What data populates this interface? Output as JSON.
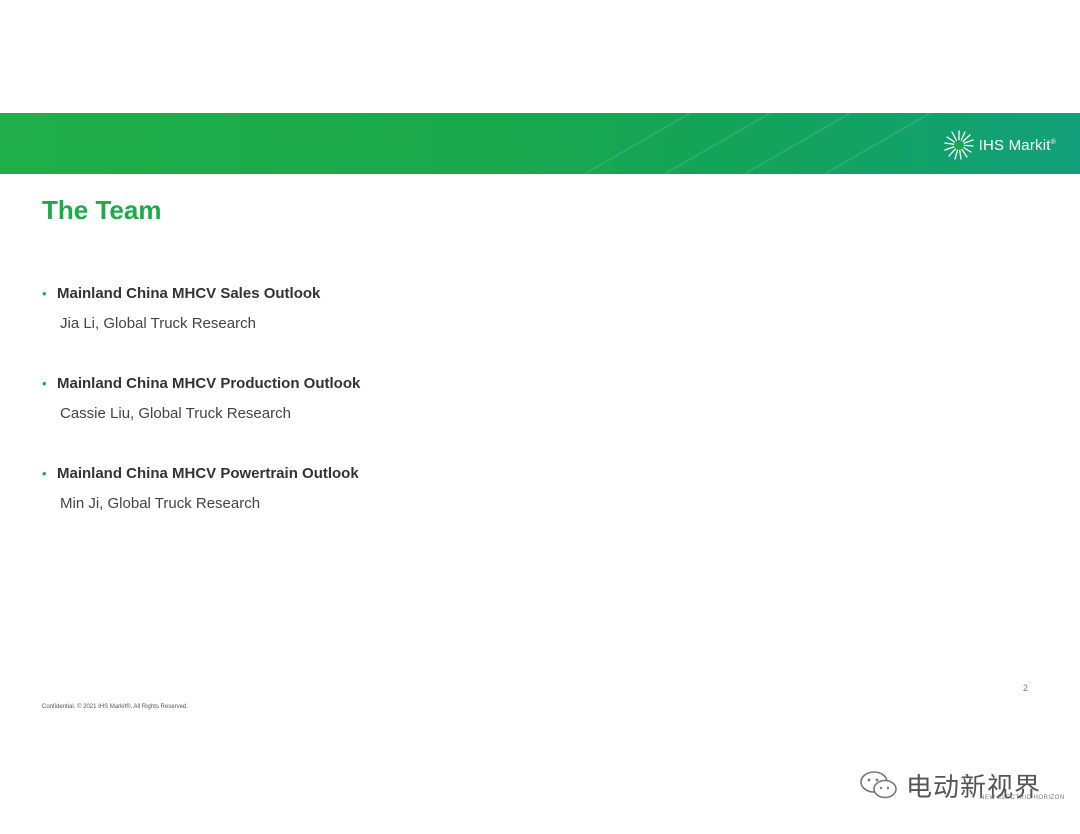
{
  "brand": {
    "name": "IHS Markit",
    "sup": "®"
  },
  "title": "The Team",
  "sections": [
    {
      "heading": "Mainland China MHCV Sales Outlook",
      "person": "Jia Li, Global Truck Research"
    },
    {
      "heading": "Mainland China MHCV Production Outlook",
      "person": "Cassie Liu, Global Truck Research"
    },
    {
      "heading": "Mainland China MHCV Powertrain Outlook",
      "person": "Min Ji, Global Truck Research"
    }
  ],
  "page_number": "2",
  "footer": "Confidential. © 2021 IHS Markit®. All Rights Reserved.",
  "watermark": {
    "text": "电动新视界",
    "sub": "NEW ELECTRIC HORIZON"
  },
  "colors": {
    "green": "#1daa4b",
    "banner": "#1aa84c"
  }
}
